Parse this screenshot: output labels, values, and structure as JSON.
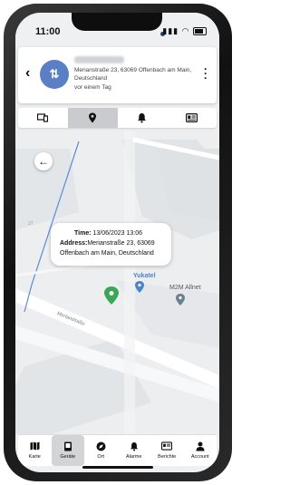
{
  "status": {
    "time": "11:00"
  },
  "device": {
    "avatar_glyph": "⇅",
    "address": "Merianstraße 23, 63069 Offenbach am Main, Deutschland",
    "last_seen": "vor einem Tag"
  },
  "tabs": [
    {
      "icon": "devices-icon",
      "glyph": "▭"
    },
    {
      "icon": "location-pin-icon",
      "glyph": "●",
      "active": true
    },
    {
      "icon": "bell-icon",
      "glyph": "🔔"
    },
    {
      "icon": "id-card-icon",
      "glyph": "▤"
    }
  ],
  "map": {
    "popup": {
      "time_label": "Time:",
      "time_value": "13/06/2023 13:06",
      "address_label": "Address:",
      "address_line1": "Merianstraße 23, 63069",
      "address_line2": "Offenbach am Main, Deutschland"
    },
    "labels": {
      "poi1": "Yukatel",
      "poi2": "M2M Allnet",
      "street": "Merianstraße",
      "house_number": "27"
    },
    "colors": {
      "marker": "#3aa757",
      "poi": "#4a86c5"
    }
  },
  "bottom_nav": [
    {
      "label": "Karte",
      "icon": "map-icon",
      "glyph": "🗺"
    },
    {
      "label": "Geräte",
      "icon": "device-icon",
      "glyph": "▦",
      "active": true
    },
    {
      "label": "Ort",
      "icon": "compass-icon",
      "glyph": "◉"
    },
    {
      "label": "Alarme",
      "icon": "bell-icon",
      "glyph": "🔔"
    },
    {
      "label": "Berichte",
      "icon": "report-icon",
      "glyph": "▤"
    },
    {
      "label": "Account",
      "icon": "account-icon",
      "glyph": "👤"
    }
  ]
}
